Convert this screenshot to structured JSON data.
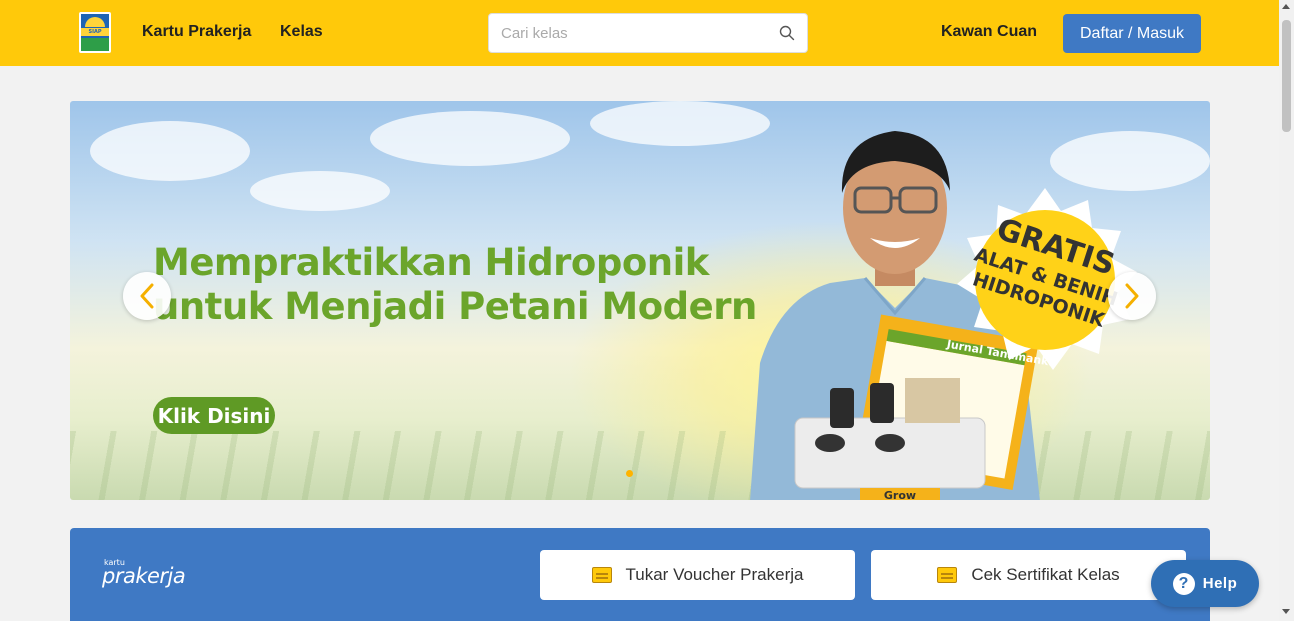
{
  "header": {
    "logo_text": "SIAP KERJA",
    "nav": [
      {
        "label": "Kartu Prakerja"
      },
      {
        "label": "Kelas"
      }
    ],
    "search": {
      "placeholder": "Cari kelas",
      "value": ""
    },
    "kawan_cuan": "Kawan Cuan",
    "login_button": "Daftar / Masuk"
  },
  "banner": {
    "title_line1": "Mempraktikkan Hidroponik",
    "title_line2": "untuk Menjadi Petani Modern",
    "cta": "Klik Disini",
    "badge_line1": "GRATIS",
    "badge_line2": "ALAT & BENIH",
    "badge_line3": "HIDROPONIK",
    "journal_title": "Jurnal Tanamanku",
    "kit_label": "Grow",
    "active_slide": 1,
    "colors": {
      "title": "#6ba52b",
      "cta": "#5f9a25",
      "dot": "#ffb300"
    }
  },
  "prakerja": {
    "logo_small": "kartu",
    "logo": "prakerja",
    "actions": [
      {
        "label": "Tukar Voucher Prakerja",
        "icon": "voucher-icon"
      },
      {
        "label": "Cek Sertifikat Kelas",
        "icon": "certificate-icon"
      }
    ]
  },
  "help": {
    "label": "Help",
    "icon": "question-icon"
  },
  "colors": {
    "header": "#ffc90a",
    "primary": "#3f79c4",
    "background": "#f2f2f2"
  }
}
